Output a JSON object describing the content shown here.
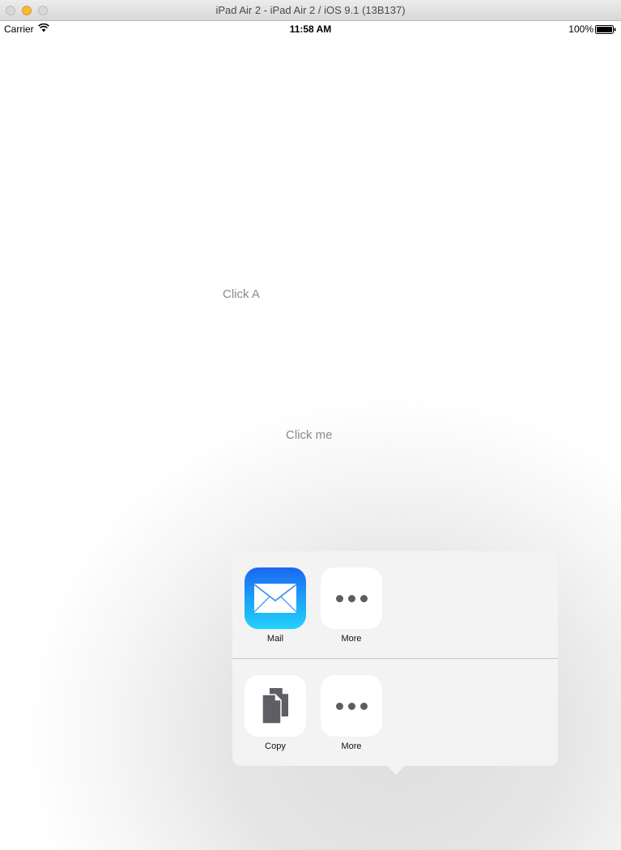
{
  "window": {
    "title": "iPad Air 2 - iPad Air 2 / iOS 9.1 (13B137)"
  },
  "status_bar": {
    "carrier": "Carrier",
    "time": "11:58 AM",
    "battery": "100%"
  },
  "main": {
    "button_a": "Click A",
    "button_b": "Click me"
  },
  "share_sheet": {
    "share_row": [
      {
        "label": "Mail",
        "icon": "mail-icon"
      },
      {
        "label": "More",
        "icon": "more-icon"
      }
    ],
    "action_row": [
      {
        "label": "Copy",
        "icon": "copy-icon"
      },
      {
        "label": "More",
        "icon": "more-icon"
      }
    ]
  },
  "colors": {
    "mail_gradient_top": "#1c66f2",
    "mail_gradient_bottom": "#22d2fb",
    "popover_bg": "#f3f3f3",
    "button_text": "#8a8a8a"
  }
}
